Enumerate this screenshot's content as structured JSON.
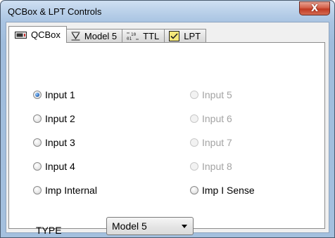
{
  "window": {
    "title": "QCBox & LPT Controls",
    "close_label": "X"
  },
  "tabs": [
    {
      "label": "QCBox",
      "icon": "device-icon",
      "active": true
    },
    {
      "label": "Model 5",
      "icon": "model-icon",
      "active": false
    },
    {
      "label": "TTL",
      "icon": "binary-icon",
      "active": false
    },
    {
      "label": "LPT",
      "icon": "checkbox-icon",
      "active": false
    }
  ],
  "inputs": {
    "left": [
      {
        "label": "Input 1",
        "checked": true,
        "enabled": true
      },
      {
        "label": "Input 2",
        "checked": false,
        "enabled": true
      },
      {
        "label": "Input 3",
        "checked": false,
        "enabled": true
      },
      {
        "label": "Input 4",
        "checked": false,
        "enabled": true
      },
      {
        "label": "Imp Internal",
        "checked": false,
        "enabled": true
      }
    ],
    "right": [
      {
        "label": "Input 5",
        "checked": false,
        "enabled": false
      },
      {
        "label": "Input 6",
        "checked": false,
        "enabled": false
      },
      {
        "label": "Input 7",
        "checked": false,
        "enabled": false
      },
      {
        "label": "Input 8",
        "checked": false,
        "enabled": false
      },
      {
        "label": "Imp I Sense",
        "checked": false,
        "enabled": true
      }
    ]
  },
  "type_field": {
    "label": "TYPE",
    "selected": "Model 5"
  }
}
